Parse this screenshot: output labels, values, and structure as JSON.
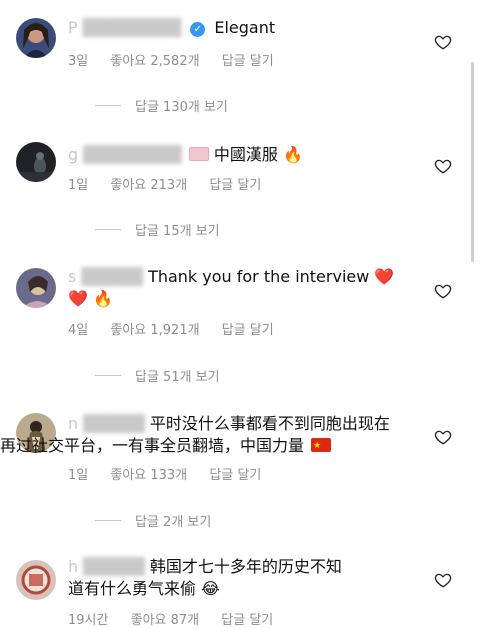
{
  "comments": [
    {
      "username_fragment": "P",
      "text": "Elegant",
      "time": "3일",
      "likes": "좋아요 2,582개",
      "reply_action": "답글 달기",
      "view_replies": "답글 130개 보기",
      "verified": true
    },
    {
      "username_fragment": "g",
      "text": "中國漢服",
      "time": "1일",
      "likes": "좋아요 213개",
      "reply_action": "답글 달기",
      "view_replies": "답글 15개 보기"
    },
    {
      "username_fragment": "s",
      "text_line1": "Thank you for the interview",
      "time": "4일",
      "likes": "좋아요 1,921개",
      "reply_action": "답글 달기",
      "view_replies": "답글 51개 보기"
    },
    {
      "username_fragment": "n",
      "text_line1": "平时没什么事都看不到同胞出现在",
      "text_line2": "再过社交平台，一有事全员翻墙，中国力量",
      "time": "1일",
      "likes": "좋아요 133개",
      "reply_action": "답글 달기",
      "view_replies": "답글 2개 보기"
    },
    {
      "username_fragment": "h",
      "text_line1": "韩国才七十多年的历史不知",
      "text_line2": "道有什么勇气来偷",
      "time": "19시간",
      "likes": "좋아요 87개",
      "reply_action": "답글 달기"
    }
  ],
  "icons": {
    "heart": "heart-outline-icon",
    "fire": "fire-emoji",
    "red_heart": "red-heart-emoji",
    "laugh": "laughing-tears-emoji",
    "flag_tw": "taiwan-flag-emoji",
    "flag_cn": "china-flag-emoji"
  }
}
